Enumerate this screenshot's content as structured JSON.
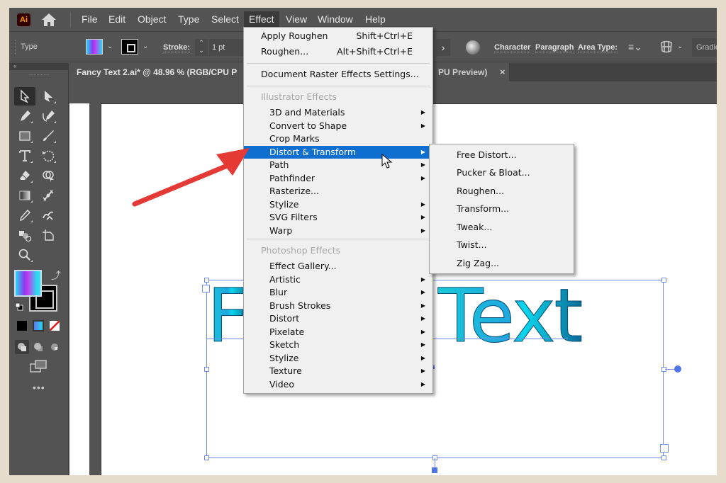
{
  "app": {
    "logo": "Ai",
    "menu": [
      "File",
      "Edit",
      "Object",
      "Type",
      "Select",
      "Effect",
      "View",
      "Window",
      "Help"
    ],
    "active_menu": "Effect"
  },
  "control_bar": {
    "type_label": "Type",
    "stroke_label": "Stroke:",
    "stroke_value": "1 pt",
    "character_label": "Character",
    "paragraph_label": "Paragraph",
    "area_type_label": "Area Type:",
    "gradient_label": "Gradie"
  },
  "document": {
    "tab_title": "Fancy Text 2.ai* @ 48.96 % (RGB/CPU P",
    "tab_title_hidden_tail": "PU Preview)",
    "close_glyph": "×"
  },
  "canvas": {
    "text_visible_left": "F",
    "text_visible_right": "Text",
    "text_full": "Fancy Text",
    "gradient_colors": [
      "#19c8d8",
      "#1ea8e0",
      "#0ad8ee",
      "#0a6b98"
    ],
    "selection_color": "#6f8ee8"
  },
  "effect_menu": {
    "top_items": [
      {
        "label": "Apply Roughen",
        "shortcut": "Shift+Ctrl+E"
      },
      {
        "label": "Roughen...",
        "shortcut": "Alt+Shift+Ctrl+E"
      }
    ],
    "document_raster": "Document Raster Effects Settings...",
    "illustrator_header": "Illustrator Effects",
    "illustrator_items": [
      {
        "label": "3D and Materials",
        "submenu": true
      },
      {
        "label": "Convert to Shape",
        "submenu": true
      },
      {
        "label": "Crop Marks",
        "submenu": false
      },
      {
        "label": "Distort & Transform",
        "submenu": true,
        "highlighted": true
      },
      {
        "label": "Path",
        "submenu": true
      },
      {
        "label": "Pathfinder",
        "submenu": true
      },
      {
        "label": "Rasterize...",
        "submenu": false
      },
      {
        "label": "Stylize",
        "submenu": true
      },
      {
        "label": "SVG Filters",
        "submenu": true
      },
      {
        "label": "Warp",
        "submenu": true
      }
    ],
    "photoshop_header": "Photoshop Effects",
    "photoshop_items": [
      {
        "label": "Effect Gallery...",
        "submenu": false
      },
      {
        "label": "Artistic",
        "submenu": true
      },
      {
        "label": "Blur",
        "submenu": true
      },
      {
        "label": "Brush Strokes",
        "submenu": true
      },
      {
        "label": "Distort",
        "submenu": true
      },
      {
        "label": "Pixelate",
        "submenu": true
      },
      {
        "label": "Sketch",
        "submenu": true
      },
      {
        "label": "Stylize",
        "submenu": true
      },
      {
        "label": "Texture",
        "submenu": true
      },
      {
        "label": "Video",
        "submenu": true
      }
    ],
    "highlight_color": "#0f6fd0"
  },
  "distort_submenu": {
    "items": [
      "Free Distort...",
      "Pucker & Bloat...",
      "Roughen...",
      "Transform...",
      "Tweak...",
      "Twist...",
      "Zig Zag..."
    ]
  },
  "annotation": {
    "arrow_color": "#e53935"
  }
}
